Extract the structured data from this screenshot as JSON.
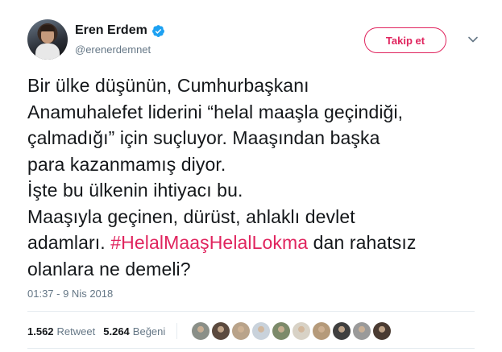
{
  "user": {
    "display_name": "Eren Erdem",
    "handle": "@erenerdemnet",
    "verified": true,
    "avatar_icon": "avatar-photo"
  },
  "actions": {
    "follow_label": "Takip et",
    "menu_icon": "chevron-down-icon"
  },
  "tweet": {
    "text_before": "Bir ülke düşünün, Cumhurbaşkanı\nAnamuhalefet liderini “helal maaşla geçindiği,\nçalmadığı” için suçluyor. Maaşından başka\npara kazanmamış diyor.\nİşte bu ülkenin ihtiyacı bu.\nMaaşıyla geçinen, dürüst, ahlaklı devlet\nadamları. ",
    "hashtag": "#HelalMaaşHelalLokma",
    "text_after": " dan rahatsız\nolanlara ne demeli?",
    "timestamp": "01:37 - 9 Nis 2018"
  },
  "stats": {
    "retweet_count": "1.562",
    "retweet_label": "Retweet",
    "like_count": "5.264",
    "like_label": "Beğeni"
  },
  "likers": [
    {
      "name": "liker-avatar-1",
      "color": "#8a8f88"
    },
    {
      "name": "liker-avatar-2",
      "color": "#5b4a3f"
    },
    {
      "name": "liker-avatar-3",
      "color": "#b9a38a"
    },
    {
      "name": "liker-avatar-4",
      "color": "#c9d2db"
    },
    {
      "name": "liker-avatar-5",
      "color": "#7c8a6a"
    },
    {
      "name": "liker-avatar-6",
      "color": "#d8d2c6"
    },
    {
      "name": "liker-avatar-7",
      "color": "#b59a7a"
    },
    {
      "name": "liker-avatar-8",
      "color": "#3f3f3f"
    },
    {
      "name": "liker-avatar-9",
      "color": "#9a9a9a"
    },
    {
      "name": "liker-avatar-10",
      "color": "#4a3b32"
    }
  ],
  "colors": {
    "accent": "#e0245e",
    "verified": "#1da1f2",
    "secondary_text": "#657786"
  }
}
